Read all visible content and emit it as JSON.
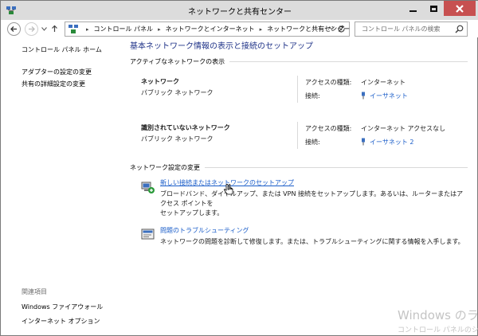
{
  "window": {
    "title": "ネットワークと共有センター"
  },
  "address": {
    "crumbs": [
      "コントロール パネル",
      "ネットワークとインターネット",
      "ネットワークと共有センター"
    ],
    "search_placeholder": "コントロール パネルの検索"
  },
  "left": {
    "home": "コントロール パネル ホーム",
    "links": [
      "アダプターの設定の変更",
      "共有の詳細設定の変更"
    ],
    "see_also_title": "関連項目",
    "see_also": [
      "Windows ファイアウォール",
      "インターネット オプション"
    ]
  },
  "main": {
    "title": "基本ネットワーク情報の表示と接続のセットアップ",
    "active_heading": "アクティブなネットワークの表示",
    "networks": [
      {
        "name": "ネットワーク",
        "type": "パブリック ネットワーク",
        "access_label": "アクセスの種類:",
        "access_value": "インターネット",
        "conn_label": "接続:",
        "conn_value": "イーサネット"
      },
      {
        "name": "識別されていないネットワーク",
        "type": "パブリック ネットワーク",
        "access_label": "アクセスの種類:",
        "access_value": "インターネット アクセスなし",
        "conn_label": "接続:",
        "conn_value": "イーサネット 2"
      }
    ],
    "settings_heading": "ネットワーク設定の変更",
    "tasks": [
      {
        "link": "新しい接続またはネットワークのセットアップ",
        "desc1": "ブロードバンド、ダイヤルアップ、または VPN 接続をセットアップします。あるいは、ルーターまたはアクセス ポイントを",
        "desc2": "セットアップします。"
      },
      {
        "link": "問題のトラブルシューティング",
        "desc1": "ネットワークの問題を診断して修復します。または、トラブルシューティングに関する情報を入手します。"
      }
    ]
  },
  "watermark": {
    "line1": "Windows のライ",
    "line2": "コントロール パネルのシ"
  },
  "colors": {
    "link": "#1a5dc9",
    "title": "#1e3287",
    "close": "#c75050"
  }
}
